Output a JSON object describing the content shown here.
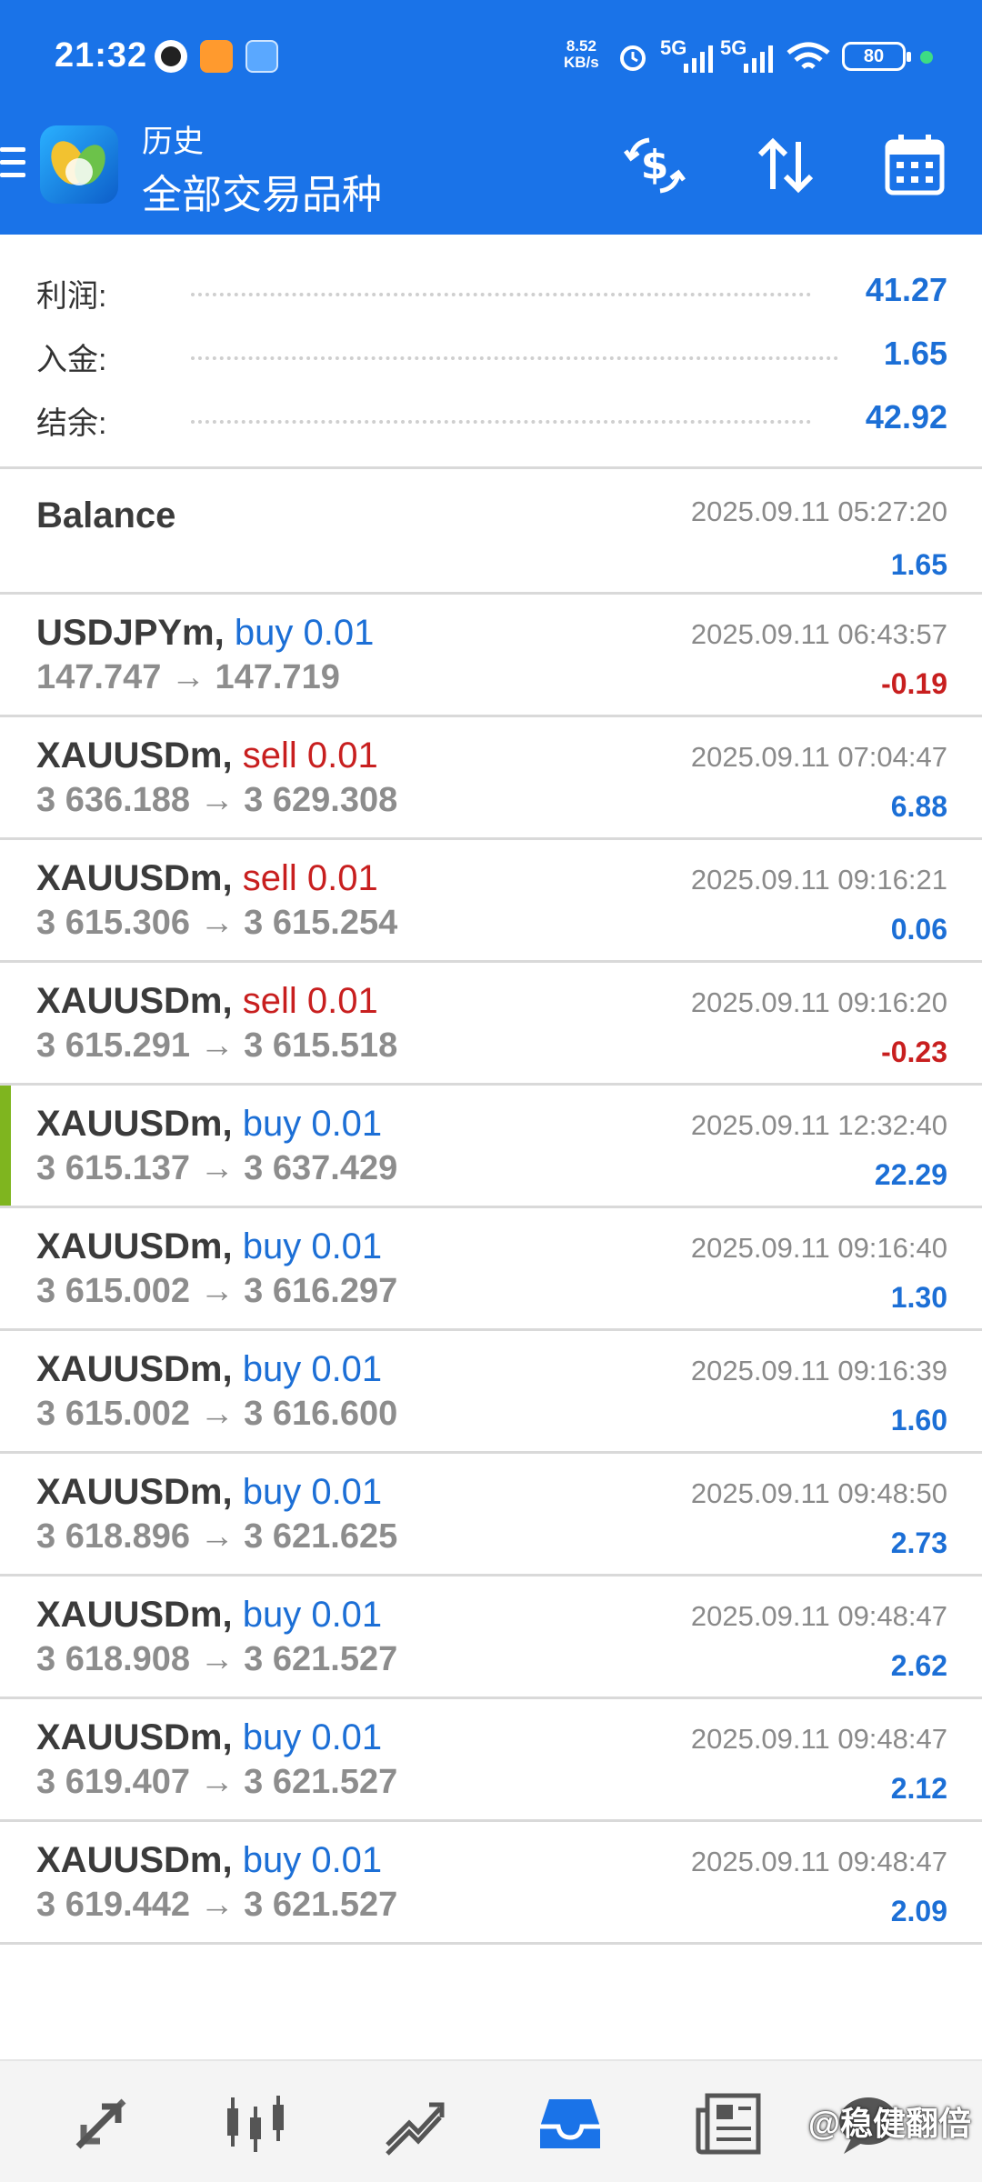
{
  "status_bar": {
    "time": "21:32",
    "net_speed_value": "8.52",
    "net_speed_unit": "KB/s",
    "signal1": "5G",
    "signal2": "5G",
    "battery": "80"
  },
  "header": {
    "subtitle": "历史",
    "title": "全部交易品种",
    "accent_color": "#1a73e8"
  },
  "summary": {
    "profit_label": "利润:",
    "profit_value": "41.27",
    "deposit_label": "入金:",
    "deposit_value": "1.65",
    "balance_label": "结余:",
    "balance_value": "42.92"
  },
  "balance_entry": {
    "label": "Balance",
    "time": "2025.09.11 05:27:20",
    "amount": "1.65"
  },
  "deals": [
    {
      "symbol": "USDJPYm,",
      "direction": "buy 0.01",
      "side": "buy",
      "prices": "147.747 → 147.719",
      "time": "2025.09.11 06:43:57",
      "profit": "-0.19"
    },
    {
      "symbol": "XAUUSDm,",
      "direction": "sell 0.01",
      "side": "sell",
      "prices": "3 636.188 → 3 629.308",
      "time": "2025.09.11 07:04:47",
      "profit": "6.88"
    },
    {
      "symbol": "XAUUSDm,",
      "direction": "sell 0.01",
      "side": "sell",
      "prices": "3 615.306 → 3 615.254",
      "time": "2025.09.11 09:16:21",
      "profit": "0.06"
    },
    {
      "symbol": "XAUUSDm,",
      "direction": "sell 0.01",
      "side": "sell",
      "prices": "3 615.291 → 3 615.518",
      "time": "2025.09.11 09:16:20",
      "profit": "-0.23"
    },
    {
      "symbol": "XAUUSDm,",
      "direction": "buy 0.01",
      "side": "buy",
      "prices": "3 615.137 → 3 637.429",
      "time": "2025.09.11 12:32:40",
      "profit": "22.29",
      "highlight": true
    },
    {
      "symbol": "XAUUSDm,",
      "direction": "buy 0.01",
      "side": "buy",
      "prices": "3 615.002 → 3 616.297",
      "time": "2025.09.11 09:16:40",
      "profit": "1.30"
    },
    {
      "symbol": "XAUUSDm,",
      "direction": "buy 0.01",
      "side": "buy",
      "prices": "3 615.002 → 3 616.600",
      "time": "2025.09.11 09:16:39",
      "profit": "1.60"
    },
    {
      "symbol": "XAUUSDm,",
      "direction": "buy 0.01",
      "side": "buy",
      "prices": "3 618.896 → 3 621.625",
      "time": "2025.09.11 09:48:50",
      "profit": "2.73"
    },
    {
      "symbol": "XAUUSDm,",
      "direction": "buy 0.01",
      "side": "buy",
      "prices": "3 618.908 → 3 621.527",
      "time": "2025.09.11 09:48:47",
      "profit": "2.62"
    },
    {
      "symbol": "XAUUSDm,",
      "direction": "buy 0.01",
      "side": "buy",
      "prices": "3 619.407 → 3 621.527",
      "time": "2025.09.11 09:48:47",
      "profit": "2.12"
    },
    {
      "symbol": "XAUUSDm,",
      "direction": "buy 0.01",
      "side": "buy",
      "prices": "3 619.442 → 3 621.527",
      "time": "2025.09.11 09:48:47",
      "profit": "2.09"
    }
  ],
  "bottom_nav": {
    "icons": [
      "quotes-icon",
      "chart-icon",
      "trade-icon",
      "history-icon",
      "news-icon",
      "chat-icon"
    ],
    "active": "history-icon",
    "watermark": "@稳健翻倍"
  },
  "colors": {
    "buy": "#1c6fd6",
    "sell": "#c81f1f",
    "highlight_bar": "#7fb51f"
  }
}
